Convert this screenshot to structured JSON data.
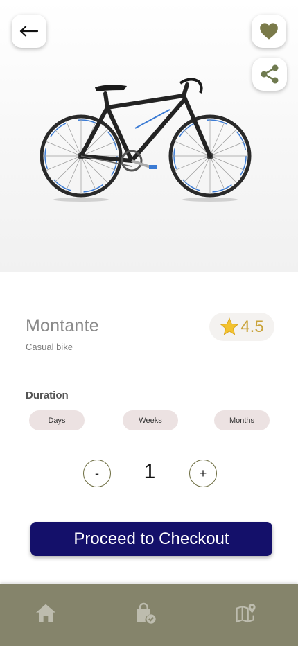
{
  "header": {
    "back_icon": "arrow-left-icon",
    "favorite_icon": "heart-icon",
    "share_icon": "share-icon"
  },
  "product": {
    "name": "Montante",
    "category": "Casual bike",
    "rating": "4.5",
    "rating_icon": "star-icon"
  },
  "duration": {
    "label": "Duration",
    "options": [
      "Days",
      "Weeks",
      "Months"
    ]
  },
  "quantity": {
    "decrement_label": "-",
    "value": "1",
    "increment_label": "+"
  },
  "checkout": {
    "label": "Proceed to Checkout"
  },
  "bottom_nav": {
    "items": [
      "home-icon",
      "bag-check-icon",
      "map-pin-icon"
    ]
  },
  "colors": {
    "accent": "#14106a",
    "nav_background": "#85846b",
    "icon_olive": "#7a7a4a",
    "chip_background": "#ece2e2",
    "rating_text": "#c9a33a"
  }
}
